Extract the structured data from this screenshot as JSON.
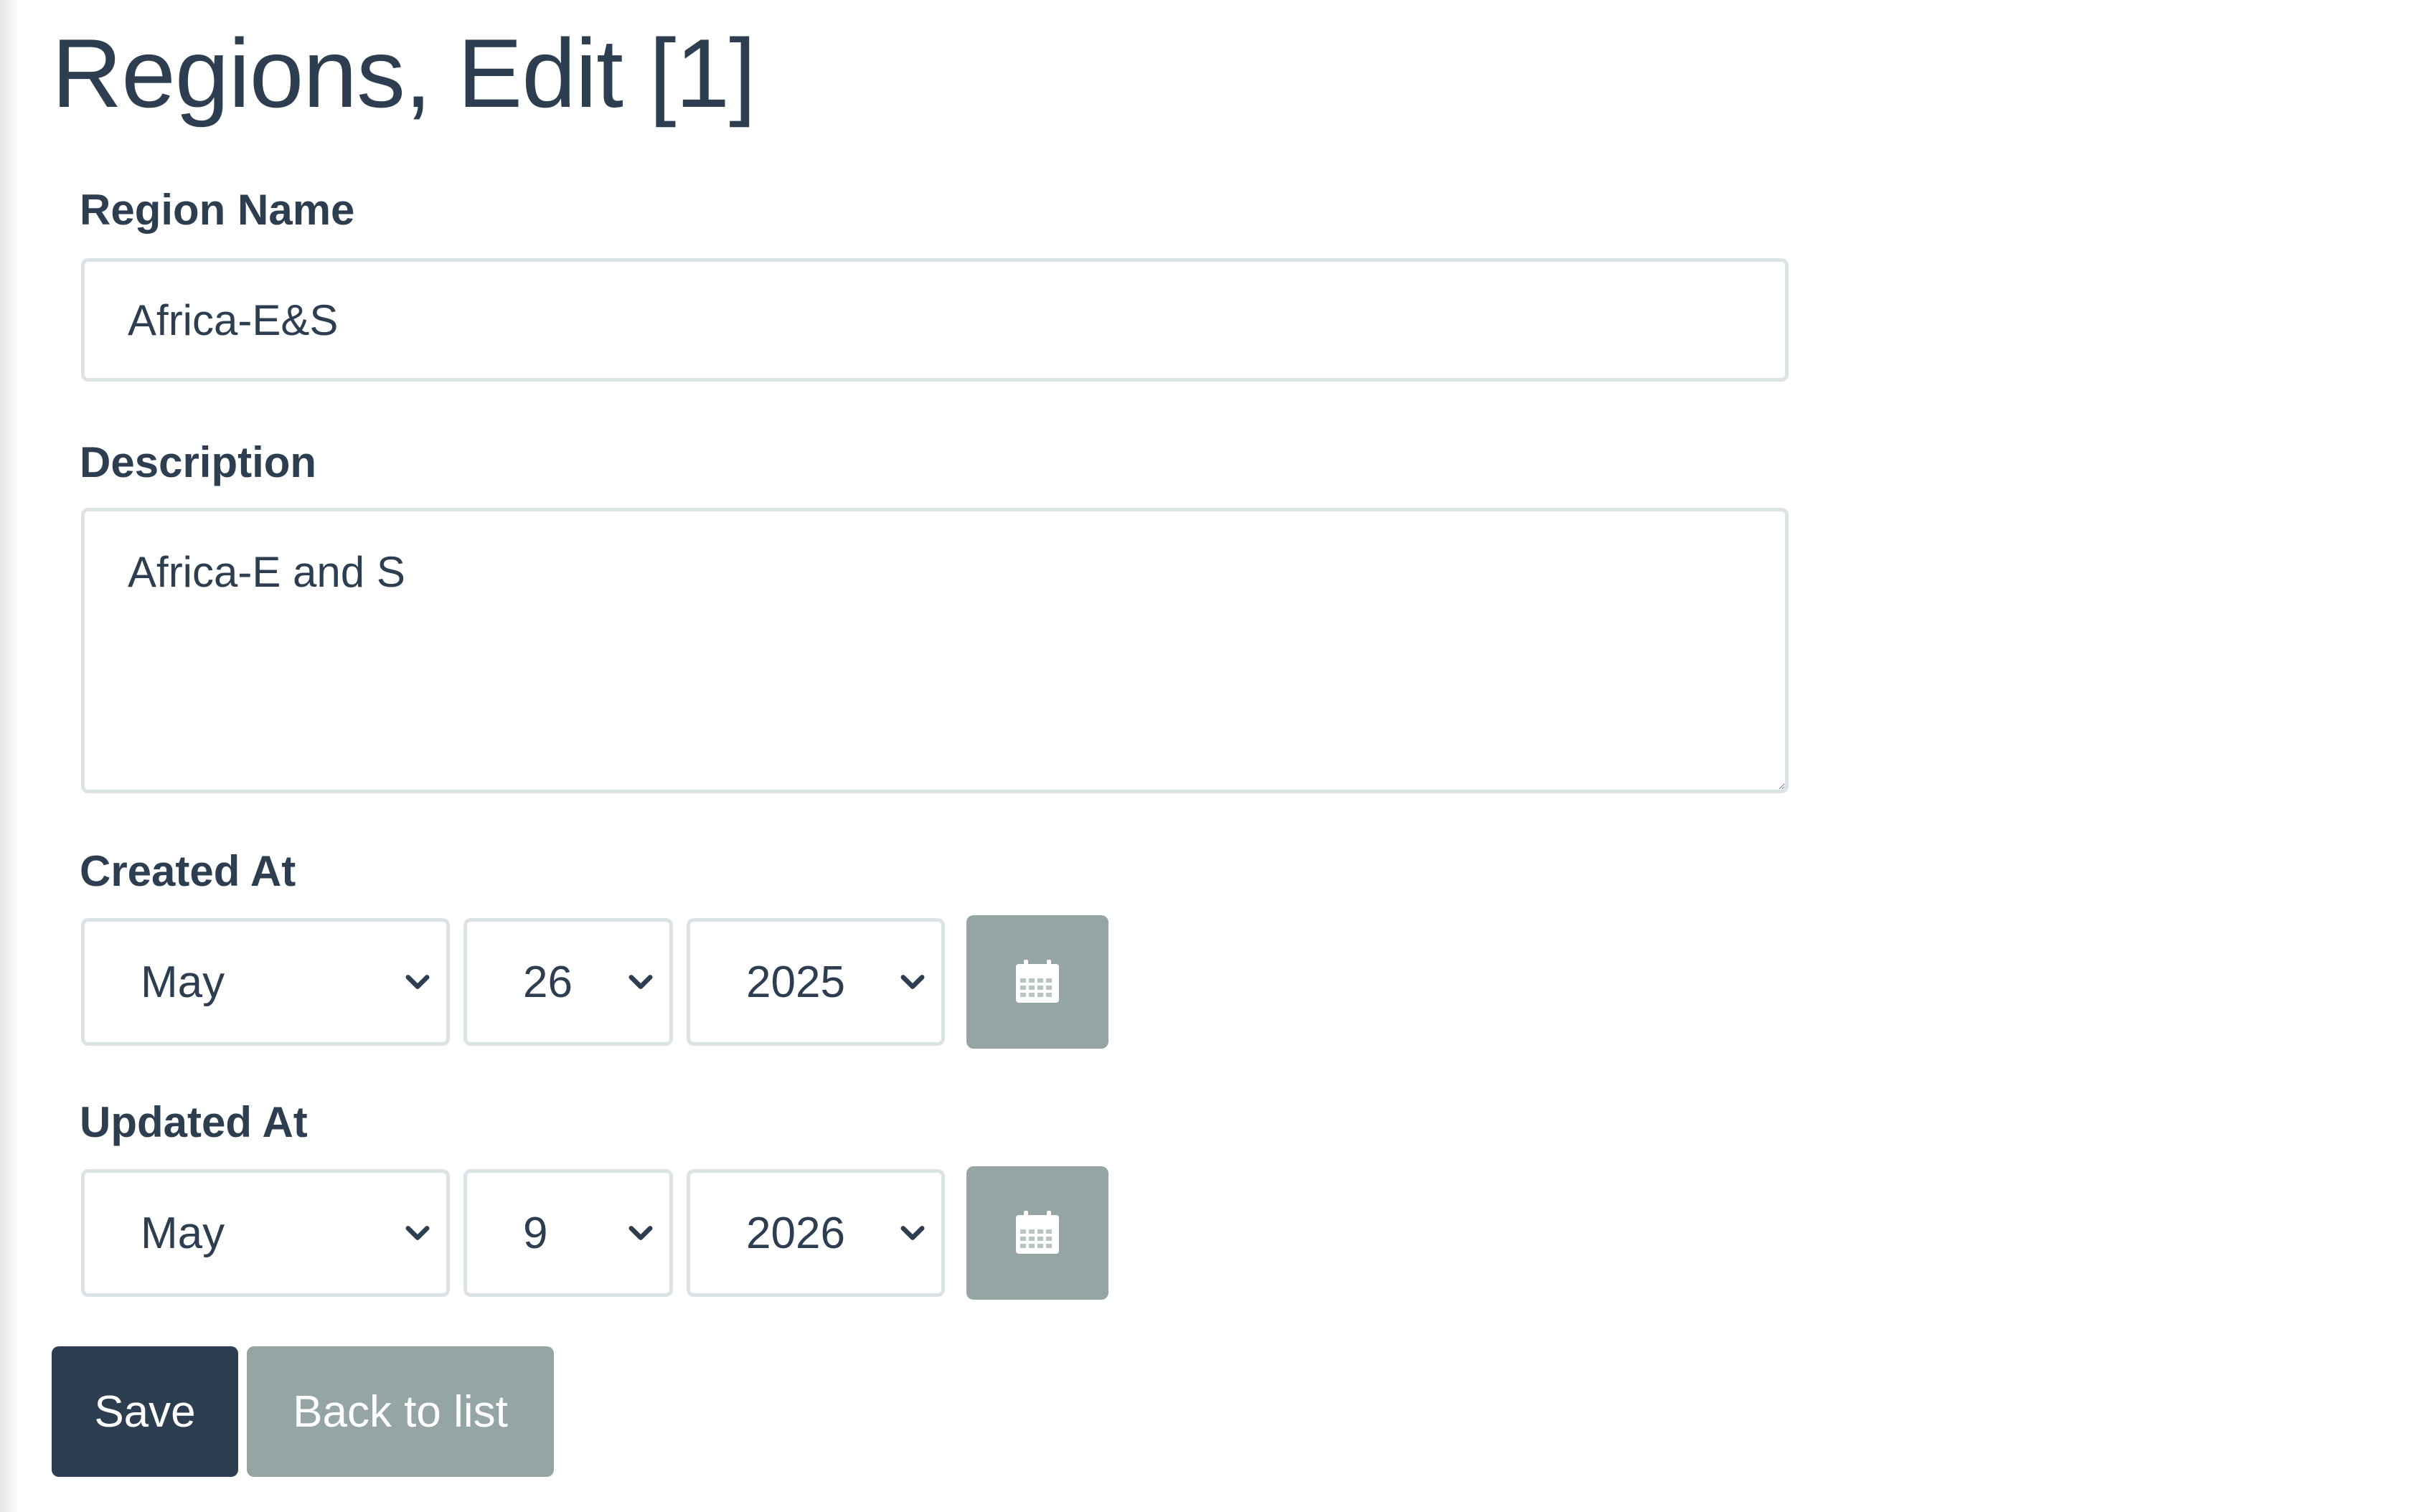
{
  "page": {
    "title": "Regions, Edit [1]"
  },
  "form": {
    "region_name": {
      "label": "Region Name",
      "value": "Africa-E&S"
    },
    "description": {
      "label": "Description",
      "value": "Africa-E and S"
    },
    "created_at": {
      "label": "Created At",
      "month": "May",
      "day": "26",
      "year": "2025"
    },
    "updated_at": {
      "label": "Updated At",
      "month": "May",
      "day": "9",
      "year": "2026"
    }
  },
  "actions": {
    "save_label": "Save",
    "back_label": "Back to list"
  },
  "colors": {
    "primary": "#2c3e50",
    "secondary": "#95a5a6",
    "border": "#dce3e6"
  },
  "icons": {
    "calendar": "calendar-icon",
    "dropdown": "chevron-down-icon"
  }
}
